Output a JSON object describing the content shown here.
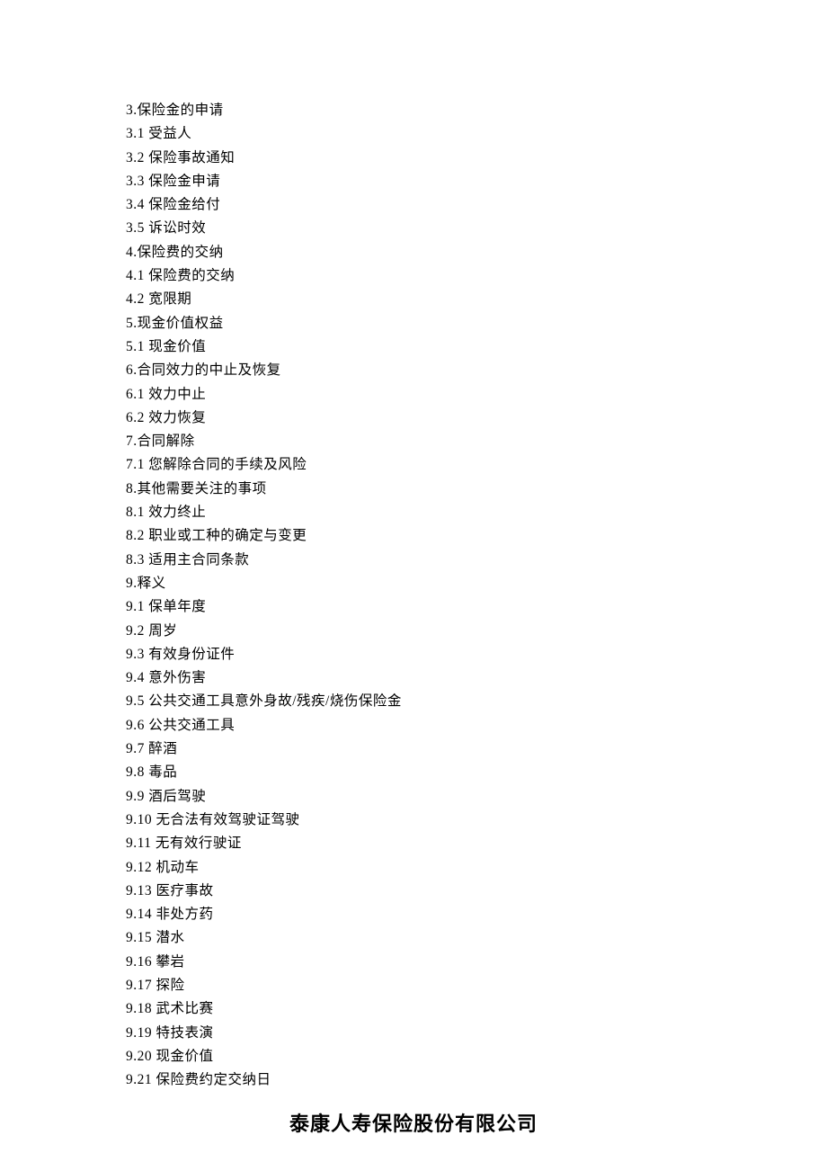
{
  "toc": [
    "3.保险金的申请",
    "3.1 受益人",
    "3.2 保险事故通知",
    "3.3 保险金申请",
    "3.4 保险金给付",
    "3.5 诉讼时效",
    "4.保险费的交纳",
    "4.1 保险费的交纳",
    "4.2 宽限期",
    "5.现金价值权益",
    "5.1 现金价值",
    "6.合同效力的中止及恢复",
    "6.1 效力中止",
    "6.2 效力恢复",
    "7.合同解除",
    "7.1 您解除合同的手续及风险",
    "8.其他需要关注的事项",
    "8.1 效力终止",
    "8.2 职业或工种的确定与变更",
    "8.3 适用主合同条款",
    "9.释义",
    "9.1 保单年度",
    "9.2 周岁",
    "9.3 有效身份证件",
    "9.4 意外伤害",
    "9.5 公共交通工具意外身故/残疾/烧伤保险金",
    "9.6 公共交通工具",
    "9.7 醉酒",
    "9.8 毒品",
    "9.9 酒后驾驶",
    "9.10 无合法有效驾驶证驾驶",
    "9.11 无有效行驶证",
    "9.12 机动车",
    "9.13 医疗事故",
    "9.14 非处方药",
    "9.15 潜水",
    "9.16 攀岩",
    "9.17 探险",
    "9.18 武术比赛",
    "9.19 特技表演",
    "9.20 现金价值",
    "9.21 保险费约定交纳日"
  ],
  "company_name": "泰康人寿保险股份有限公司"
}
